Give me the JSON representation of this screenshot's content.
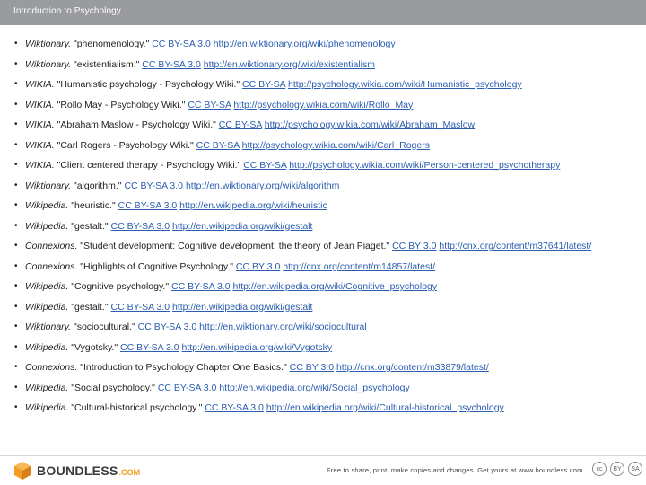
{
  "header": {
    "title": "Introduction to Psychology"
  },
  "references": [
    {
      "source": "Wiktionary.",
      "text": " \"phenomenology.\" ",
      "license": "CC BY-SA 3.0",
      "url": "http://en.wiktionary.org/wiki/phenomenology"
    },
    {
      "source": "Wiktionary.",
      "text": " \"existentialism.\" ",
      "license": "CC BY-SA 3.0",
      "url": "http://en.wiktionary.org/wiki/existentialism"
    },
    {
      "source": "WIKIA.",
      "text": " \"Humanistic psychology - Psychology Wiki.\" ",
      "license": "CC BY-SA",
      "url": "http://psychology.wikia.com/wiki/Humanistic_psychology"
    },
    {
      "source": "WIKIA.",
      "text": " \"Rollo May - Psychology Wiki.\" ",
      "license": "CC BY-SA",
      "url": "http://psychology.wikia.com/wiki/Rollo_May"
    },
    {
      "source": "WIKIA.",
      "text": " \"Abraham Maslow - Psychology Wiki.\" ",
      "license": "CC BY-SA",
      "url": "http://psychology.wikia.com/wiki/Abraham_Maslow"
    },
    {
      "source": "WIKIA.",
      "text": " \"Carl Rogers - Psychology Wiki.\" ",
      "license": "CC BY-SA",
      "url": "http://psychology.wikia.com/wiki/Carl_Rogers"
    },
    {
      "source": "WIKIA.",
      "text": " \"Client centered therapy - Psychology Wiki.\" ",
      "license": "CC BY-SA",
      "url": "http://psychology.wikia.com/wiki/Person-centered_psychotherapy"
    },
    {
      "source": "Wiktionary.",
      "text": " \"algorithm.\" ",
      "license": "CC BY-SA 3.0",
      "url": "http://en.wiktionary.org/wiki/algorithm"
    },
    {
      "source": "Wikipedia.",
      "text": " \"heuristic.\" ",
      "license": "CC BY-SA 3.0",
      "url": "http://en.wikipedia.org/wiki/heuristic"
    },
    {
      "source": "Wikipedia.",
      "text": " \"gestalt.\" ",
      "license": "CC BY-SA 3.0",
      "url": "http://en.wikipedia.org/wiki/gestalt"
    },
    {
      "source": "Connexions.",
      "text": " \"Student development: Cognitive development: the theory of Jean Piaget.\" ",
      "license": "CC BY 3.0",
      "url": "http://cnx.org/content/m37641/latest/"
    },
    {
      "source": "Connexions.",
      "text": " \"Highlights of Cognitive Psychology.\" ",
      "license": "CC BY 3.0",
      "url": "http://cnx.org/content/m14857/latest/"
    },
    {
      "source": "Wikipedia.",
      "text": " \"Cognitive psychology.\" ",
      "license": "CC BY-SA 3.0",
      "url": "http://en.wikipedia.org/wiki/Cognitive_psychology"
    },
    {
      "source": "Wikipedia.",
      "text": " \"gestalt.\" ",
      "license": "CC BY-SA 3.0",
      "url": "http://en.wikipedia.org/wiki/gestalt"
    },
    {
      "source": "Wiktionary.",
      "text": " \"sociocultural.\" ",
      "license": "CC BY-SA 3.0",
      "url": "http://en.wiktionary.org/wiki/sociocultural"
    },
    {
      "source": "Wikipedia.",
      "text": " \"Vygotsky.\" ",
      "license": "CC BY-SA 3.0",
      "url": "http://en.wikipedia.org/wiki/Vygotsky"
    },
    {
      "source": "Connexions.",
      "text": " \"Introduction to Psychology Chapter One Basics.\" ",
      "license": "CC BY 3.0",
      "url": "http://cnx.org/content/m33879/latest/"
    },
    {
      "source": "Wikipedia.",
      "text": " \"Social psychology.\" ",
      "license": "CC BY-SA 3.0",
      "url": "http://en.wikipedia.org/wiki/Social_psychology"
    },
    {
      "source": "Wikipedia.",
      "text": " \"Cultural-historical psychology.\" ",
      "license": "CC BY-SA 3.0",
      "url": "http://en.wikipedia.org/wiki/Cultural-historical_psychology"
    }
  ],
  "footer": {
    "logo_word": "BOUNDLESS",
    "logo_tld": ".COM",
    "note": "Free to share, print, make copies and changes. Get yours at www.boundless.com",
    "cc_badges": [
      "cc",
      "BY",
      "SA"
    ],
    "icon": "boundless-logo-icon",
    "accent_color": "#f39c1f",
    "link_color": "#2a5db0",
    "header_color": "#999b9e"
  }
}
